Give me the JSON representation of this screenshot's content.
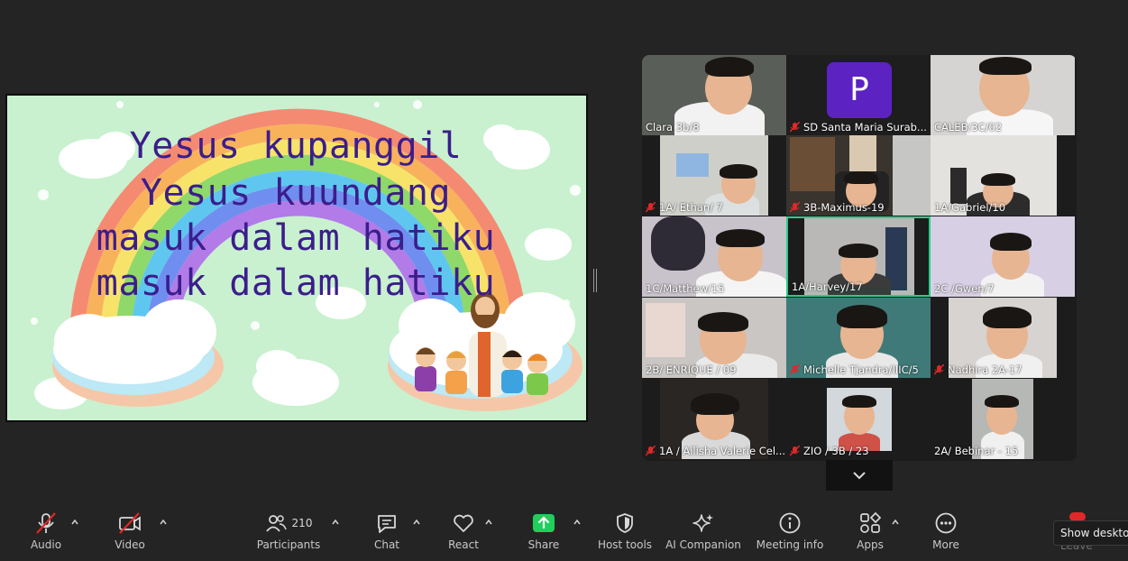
{
  "slide": {
    "lines": [
      "Yesus kupanggil",
      "Yesus kuundang",
      "masuk dalam hatiku",
      "masuk dalam hatiku"
    ],
    "text_color": "#3b1d8c",
    "background": "#c9f1cf"
  },
  "gallery": {
    "tiles": [
      {
        "name": "Clara 3b/8",
        "muted": false
      },
      {
        "name": "SD Santa Maria Surab...",
        "muted": true,
        "avatar_letter": "P"
      },
      {
        "name": "CALEB/3C/02",
        "muted": false
      },
      {
        "name": "1A/ Ethan/ 7",
        "muted": true
      },
      {
        "name": "3B-Maximus-19",
        "muted": true
      },
      {
        "name": "1A/Gabriel/10",
        "muted": false
      },
      {
        "name": "1C/Matthew/15",
        "muted": false
      },
      {
        "name": "1A/Harvey/17",
        "muted": false,
        "active": true
      },
      {
        "name": "2C /Gwen/7",
        "muted": false
      },
      {
        "name": "2B/ ENRIQUE / 09",
        "muted": false
      },
      {
        "name": "Michelle Tjandra/IIIC/5",
        "muted": true
      },
      {
        "name": "Nadhira 2A-17",
        "muted": true
      },
      {
        "name": "1A / Ailisha Valerie Cel...",
        "muted": true
      },
      {
        "name": "ZIO / 3B / 23",
        "muted": true
      },
      {
        "name": "2A/ Bebinar - 15",
        "muted": false
      }
    ],
    "more_icon": "chevron-down-icon"
  },
  "toolbar": {
    "audio": "Audio",
    "video": "Video",
    "participants": "Participants",
    "participants_count": "210",
    "chat": "Chat",
    "react": "React",
    "share": "Share",
    "host_tools": "Host tools",
    "ai_companion": "AI Companion",
    "meeting_info": "Meeting info",
    "apps": "Apps",
    "more": "More",
    "leave": "Leave",
    "share_color": "#1fcf5c",
    "mute_color": "#e02828"
  },
  "tooltip": {
    "text": "Show desktop"
  }
}
